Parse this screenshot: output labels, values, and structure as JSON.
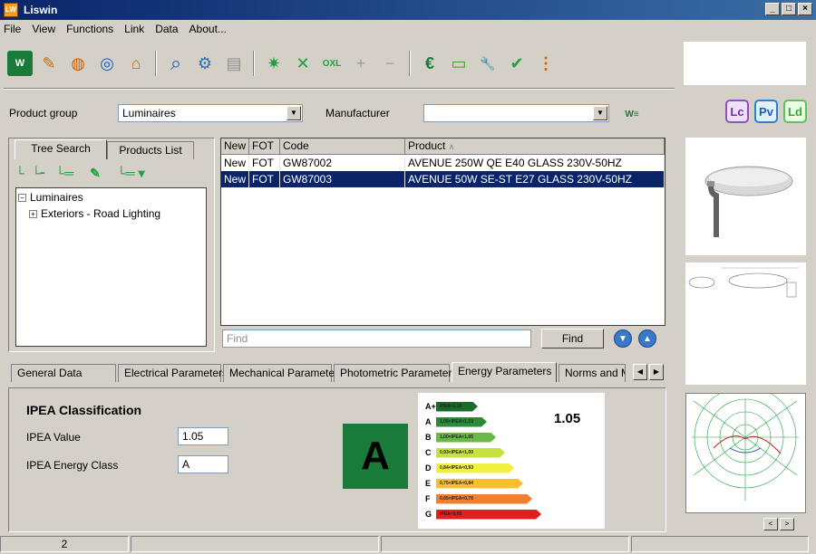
{
  "window": {
    "title": "Liswin",
    "icon_text": "LW"
  },
  "menu": [
    "File",
    "View",
    "Functions",
    "Link",
    "Data",
    "About..."
  ],
  "toolbar": [
    {
      "icon": "wg-icon",
      "glyph": "W"
    },
    {
      "icon": "tools-icon",
      "glyph": "✎"
    },
    {
      "icon": "globe-icon",
      "glyph": "◍"
    },
    {
      "icon": "globe-search-icon",
      "glyph": "◎"
    },
    {
      "icon": "network-icon",
      "glyph": "⌂"
    },
    {
      "icon": "search-icon",
      "glyph": "⌕"
    },
    {
      "icon": "settings-search-icon",
      "glyph": "⚙"
    },
    {
      "icon": "document-icon",
      "glyph": "▤"
    },
    {
      "icon": "star-list-icon",
      "glyph": "✷"
    },
    {
      "icon": "cross-list-icon",
      "glyph": "✕"
    },
    {
      "icon": "oxl-icon",
      "glyph": "OXL"
    },
    {
      "icon": "add-list-icon",
      "glyph": "+"
    },
    {
      "icon": "remove-list-icon",
      "glyph": "−"
    },
    {
      "icon": "euro-icon",
      "glyph": "€"
    },
    {
      "icon": "money-icon",
      "glyph": "▭"
    },
    {
      "icon": "wrench-icon",
      "glyph": "🔧"
    },
    {
      "icon": "tools-check-icon",
      "glyph": "✔"
    },
    {
      "icon": "abacus-icon",
      "glyph": "⋮"
    }
  ],
  "filters": {
    "product_group_label": "Product group",
    "product_group_value": "Luminaires",
    "manufacturer_label": "Manufacturer",
    "manufacturer_value": ""
  },
  "badges": [
    "Lc",
    "Pv",
    "Ld"
  ],
  "left_tabs": [
    "Tree Search",
    "Products List"
  ],
  "tree": {
    "root": "Luminaires",
    "child": "Exteriors - Road Lighting"
  },
  "grid": {
    "columns": [
      "New",
      "FOT",
      "Code",
      "Product"
    ],
    "rows": [
      {
        "new": "New",
        "fot": "FOT",
        "code": "GW87002",
        "product": "AVENUE 250W QE E40 GLASS 230V-50HZ",
        "selected": false
      },
      {
        "new": "New",
        "fot": "FOT",
        "code": "GW87003",
        "product": "AVENUE 50W SE-ST E27 GLASS 230V-50HZ",
        "selected": true
      }
    ]
  },
  "find": {
    "placeholder": "Find",
    "button": "Find"
  },
  "bottom_tabs": [
    "General Data",
    "Electrical Parameters",
    "Mechanical Parameters",
    "Photometric Parameters",
    "Energy Parameters",
    "Norms and Ma"
  ],
  "ipea": {
    "heading": "IPEA Classification",
    "value_label": "IPEA Value",
    "value": "1.05",
    "class_label": "IPEA Energy Class",
    "class_value": "A",
    "big_letter": "A",
    "chart_value": "1.05"
  },
  "energy_scale": [
    {
      "letter": "A+",
      "label": "IPEA>1,10",
      "color": "#1a6a2a"
    },
    {
      "letter": "A",
      "label": "1,05<IPEA<1,10",
      "color": "#2a8a3a"
    },
    {
      "letter": "B",
      "label": "1,00<IPEA<1,05",
      "color": "#6ab84a"
    },
    {
      "letter": "C",
      "label": "0,93<IPEA<1,00",
      "color": "#c8e040"
    },
    {
      "letter": "D",
      "label": "0,84<IPEA<0,93",
      "color": "#f0f040"
    },
    {
      "letter": "E",
      "label": "0,75<IPEA<0,84",
      "color": "#f8c030"
    },
    {
      "letter": "F",
      "label": "0,65<IPEA<0,75",
      "color": "#f08030"
    },
    {
      "letter": "G",
      "label": "IPEA<0,65",
      "color": "#e02020"
    }
  ],
  "status": {
    "page": "2"
  }
}
